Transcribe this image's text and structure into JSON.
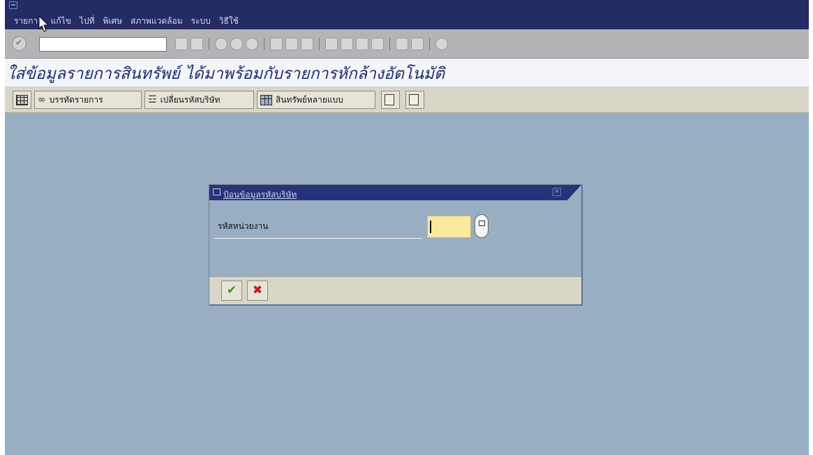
{
  "menu": {
    "items": [
      "รายการ",
      "แก้ไข",
      "ไปที่",
      "พิเศษ",
      "สภาพแวดล้อม",
      "ระบบ",
      "วิธีใช้"
    ]
  },
  "standard_toolbar": {
    "command_field_value": ""
  },
  "page": {
    "title": "ใส่ข้อมูลรายการสินทรัพย์ ได้มาพร้อมกับรายการหักล้างอัตโนมัติ"
  },
  "app_toolbar": {
    "line_items_label": "บรรทัดรายการ",
    "change_company_label": "เปลี่ยนรหัสบริษัท",
    "multiple_assets_label": "สินทรัพย์หลายแบบ"
  },
  "dialog": {
    "title": "ป้อนข้อมูลรหัสบริษัท",
    "field_label": "รหัสหน่วยงาน",
    "field_value": ""
  },
  "colors": {
    "menubar": "#232c64",
    "background": "#98afc3",
    "title_text": "#1d2d6e",
    "input_highlight": "#fbe9a1"
  },
  "icons": [
    "enter-icon",
    "dropdown-icon",
    "back-icon",
    "save-icon",
    "exit-icon",
    "cancel-icon",
    "print-icon",
    "find-icon",
    "help-icon",
    "ok-icon",
    "cancel-x-icon",
    "possible-entries-icon"
  ]
}
